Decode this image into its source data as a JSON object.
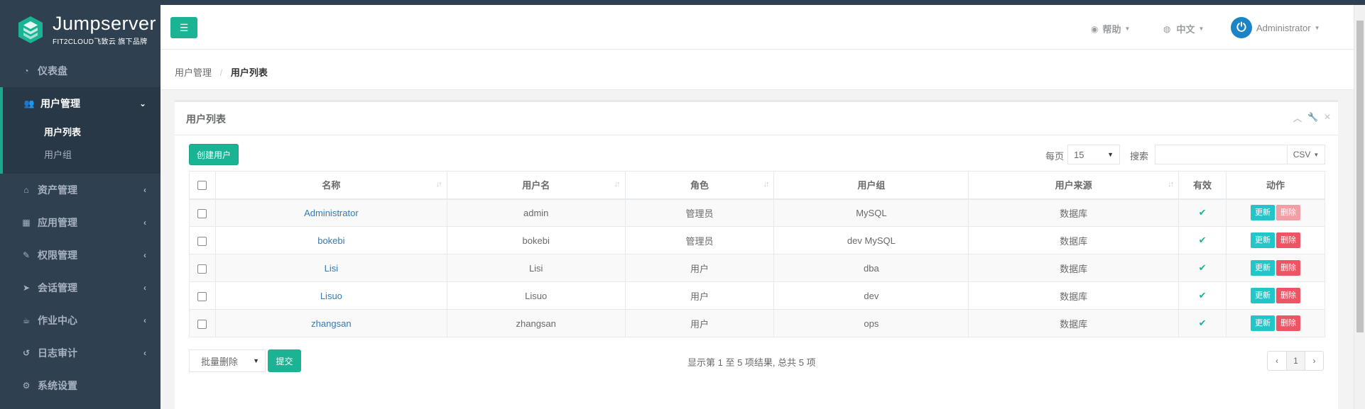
{
  "brand": {
    "title": "Jumpserver",
    "subtitle": "FIT2CLOUD飞致云 旗下品牌",
    "accent": "#1ab394",
    "sidebar_bg": "#2f4050"
  },
  "sidebar": {
    "items": [
      {
        "label": "仪表盘",
        "icon": "dashboard-icon"
      },
      {
        "label": "用户管理",
        "icon": "users-icon",
        "active": true,
        "sub": [
          {
            "label": "用户列表",
            "active": true
          },
          {
            "label": "用户组"
          }
        ]
      },
      {
        "label": "资产管理",
        "icon": "inbox-icon"
      },
      {
        "label": "应用管理",
        "icon": "grid-icon"
      },
      {
        "label": "权限管理",
        "icon": "edit-icon"
      },
      {
        "label": "会话管理",
        "icon": "rocket-icon"
      },
      {
        "label": "作业中心",
        "icon": "coffee-icon"
      },
      {
        "label": "日志审计",
        "icon": "history-icon"
      },
      {
        "label": "系统设置",
        "icon": "gears-icon"
      }
    ]
  },
  "header": {
    "help": "帮助",
    "language": "中文",
    "user": "Administrator"
  },
  "breadcrumb": {
    "parent": "用户管理",
    "current": "用户列表"
  },
  "panel": {
    "title": "用户列表"
  },
  "toolbar": {
    "create": "创建用户",
    "per_page_label": "每页",
    "per_page_value": "15",
    "search_label": "搜索",
    "search_value": "",
    "export": "CSV"
  },
  "table": {
    "columns": [
      "名称",
      "用户名",
      "角色",
      "用户组",
      "用户来源",
      "有效",
      "动作"
    ],
    "rows": [
      {
        "name": "Administrator",
        "username": "admin",
        "role": "管理员",
        "group": "MySQL",
        "source": "数据库",
        "valid": true,
        "update": "更新",
        "delete": "删除",
        "delete_disabled": true
      },
      {
        "name": "bokebi",
        "username": "bokebi",
        "role": "管理员",
        "group": "dev MySQL",
        "source": "数据库",
        "valid": true,
        "update": "更新",
        "delete": "删除"
      },
      {
        "name": "Lisi",
        "username": "Lisi",
        "role": "用户",
        "group": "dba",
        "source": "数据库",
        "valid": true,
        "update": "更新",
        "delete": "删除"
      },
      {
        "name": "Lisuo",
        "username": "Lisuo",
        "role": "用户",
        "group": "dev",
        "source": "数据库",
        "valid": true,
        "update": "更新",
        "delete": "删除"
      },
      {
        "name": "zhangsan",
        "username": "zhangsan",
        "role": "用户",
        "group": "ops",
        "source": "数据库",
        "valid": true,
        "update": "更新",
        "delete": "删除"
      }
    ]
  },
  "footer": {
    "bulk_action": "批量删除",
    "submit": "提交",
    "info": "显示第 1 至 5 项结果, 总共 5 项",
    "page": "1",
    "prev": "‹",
    "next": "›"
  }
}
